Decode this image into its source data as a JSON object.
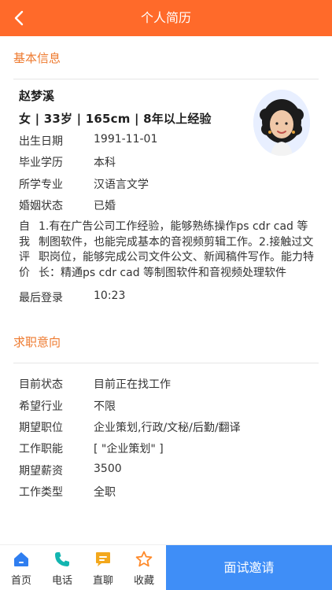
{
  "header": {
    "title": "个人简历"
  },
  "basic": {
    "section_title": "基本信息",
    "name": "赵梦溪",
    "summary": "女 | 33岁 | 165cm | 8年以上经验",
    "fields": [
      {
        "label": "出生日期",
        "value": "1991-11-01"
      },
      {
        "label": "毕业学历",
        "value": "本科"
      },
      {
        "label": "所学专业",
        "value": "汉语言文学"
      },
      {
        "label": "婚姻状态",
        "value": "已婚"
      }
    ],
    "intro_label": "自我评价",
    "intro_text": "1.有在广告公司工作经验，能够熟练操作ps cdr cad 等制图软件，也能完成基本的音视频剪辑工作。2.接触过文职岗位，能够完成公司文件公文、新闻稿件写作。能力特长：精通ps cdr cad 等制图软件和音视频处理软件",
    "last_login_label": "最后登录",
    "last_login_value": "10:23"
  },
  "intent": {
    "section_title": "求职意向",
    "fields": [
      {
        "label": "目前状态",
        "value": "目前正在找工作"
      },
      {
        "label": "希望行业",
        "value": "不限"
      },
      {
        "label": "期望职位",
        "value": "企业策划,行政/文秘/后勤/翻译"
      },
      {
        "label": "工作职能",
        "value": "[ \"企业策划\" ]"
      },
      {
        "label": "期望薪资",
        "value": "3500"
      },
      {
        "label": "工作类型",
        "value": "全职"
      }
    ]
  },
  "bottom_nav": {
    "tabs": [
      {
        "label": "首页",
        "icon": "home-icon"
      },
      {
        "label": "电话",
        "icon": "phone-icon"
      },
      {
        "label": "直聊",
        "icon": "chat-icon"
      },
      {
        "label": "收藏",
        "icon": "star-icon"
      }
    ],
    "invite_label": "面试邀请"
  },
  "colors": {
    "header": "#ff6a2a",
    "section_title": "#ee7a2f",
    "invite": "#3f8ef7",
    "nav_icon": "#2f7ef0",
    "star": "#ff8a2a"
  }
}
